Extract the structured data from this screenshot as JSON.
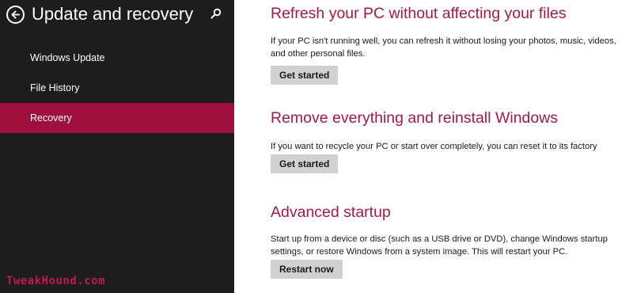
{
  "sidebar": {
    "title": "Update and recovery",
    "items": [
      {
        "label": "Windows Update",
        "active": false
      },
      {
        "label": "File History",
        "active": false
      },
      {
        "label": "Recovery",
        "active": true
      }
    ],
    "back_icon": "back-arrow-icon",
    "search_icon": "search-icon"
  },
  "watermark": "TweakHound.com",
  "sections": [
    {
      "heading": "Refresh your PC without affecting your files",
      "description": "If your PC isn't running well, you can refresh it without losing your photos, music, videos, and other personal files.",
      "button": "Get started"
    },
    {
      "heading": "Remove everything and reinstall Windows",
      "description": "If you want to recycle your PC or start over completely, you can reset it to its factory settings.",
      "button": "Get started"
    },
    {
      "heading": "Advanced startup",
      "description": "Start up from a device or disc (such as a USB drive or DVD), change Windows startup settings, or restore Windows from a system image. This will restart your PC.",
      "button": "Restart now"
    }
  ],
  "colors": {
    "sidebar_bg": "#1d1d1d",
    "accent": "#a0103e",
    "heading": "#a5174b",
    "button_bg": "#d1d1d1"
  }
}
